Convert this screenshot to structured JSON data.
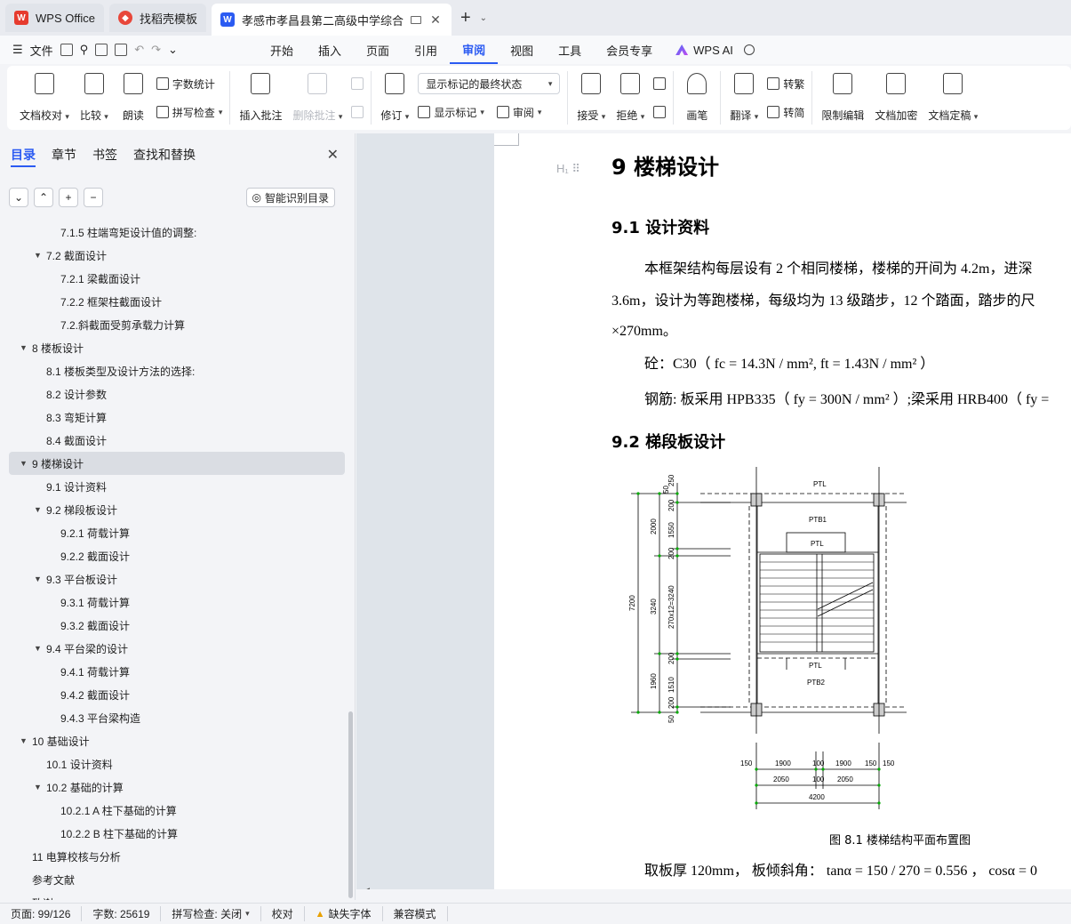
{
  "tabs": [
    {
      "label": "WPS Office",
      "icon": "wps-logo-icon"
    },
    {
      "label": "找稻壳模板",
      "icon": "docer-logo-icon"
    },
    {
      "label": "孝感市孝昌县第二高级中学综合",
      "icon": "writer-logo-icon",
      "active": true
    }
  ],
  "menu": {
    "file": "文件",
    "items": [
      "开始",
      "插入",
      "页面",
      "引用",
      "审阅",
      "视图",
      "工具",
      "会员专享"
    ],
    "active": "审阅",
    "ai": "WPS AI"
  },
  "ribbon": {
    "doc_compare": "文档校对",
    "compare": "比较",
    "read_aloud": "朗读",
    "word_count": "字数统计",
    "spell_check": "拼写检查",
    "insert_comment": "插入批注",
    "delete_comment": "删除批注",
    "track_changes": "修订",
    "markup_dropdown": "显示标记的最终状态",
    "show_markup": "显示标记",
    "review": "审阅",
    "accept": "接受",
    "reject": "拒绝",
    "ink": "画笔",
    "translate": "翻译",
    "to_traditional": "转繁",
    "to_simplified": "转简",
    "restrict_edit": "限制编辑",
    "encrypt": "文档加密",
    "finalize": "文档定稿"
  },
  "panel": {
    "tabs": [
      "目录",
      "章节",
      "书签",
      "查找和替换"
    ],
    "active_tab": "目录",
    "smart_toc": "智能识别目录",
    "toc": [
      {
        "level": 3,
        "text": "7.1.5 柱端弯矩设计值的调整:",
        "arrow": false
      },
      {
        "level": 2,
        "text": "7.2 截面设计",
        "arrow": true
      },
      {
        "level": 3,
        "text": "7.2.1 梁截面设计",
        "arrow": false
      },
      {
        "level": 3,
        "text": "7.2.2 框架柱截面设计",
        "arrow": false
      },
      {
        "level": 3,
        "text": "7.2.斜截面受剪承载力计算",
        "arrow": false
      },
      {
        "level": 1,
        "text": "8  楼板设计",
        "arrow": true
      },
      {
        "level": 2,
        "text": "8.1 楼板类型及设计方法的选择:",
        "arrow": false
      },
      {
        "level": 2,
        "text": "8.2 设计参数",
        "arrow": false
      },
      {
        "level": 2,
        "text": "8.3 弯矩计算",
        "arrow": false
      },
      {
        "level": 2,
        "text": "8.4 截面设计",
        "arrow": false
      },
      {
        "level": 1,
        "text": "9  楼梯设计",
        "arrow": true,
        "selected": true
      },
      {
        "level": 2,
        "text": "9.1 设计资料",
        "arrow": false
      },
      {
        "level": 2,
        "text": "9.2 梯段板设计",
        "arrow": true
      },
      {
        "level": 3,
        "text": "9.2.1 荷载计算",
        "arrow": false
      },
      {
        "level": 3,
        "text": "9.2.2 截面设计",
        "arrow": false
      },
      {
        "level": 2,
        "text": "9.3 平台板设计",
        "arrow": true
      },
      {
        "level": 3,
        "text": "9.3.1 荷载计算",
        "arrow": false
      },
      {
        "level": 3,
        "text": "9.3.2 截面设计",
        "arrow": false
      },
      {
        "level": 2,
        "text": "9.4 平台梁的设计",
        "arrow": true
      },
      {
        "level": 3,
        "text": "9.4.1 荷载计算",
        "arrow": false
      },
      {
        "level": 3,
        "text": "9.4.2 截面设计",
        "arrow": false
      },
      {
        "level": 3,
        "text": "9.4.3 平台梁构造",
        "arrow": false
      },
      {
        "level": 1,
        "text": "10  基础设计",
        "arrow": true
      },
      {
        "level": 2,
        "text": "10.1 设计资料",
        "arrow": false
      },
      {
        "level": 2,
        "text": "10.2 基础的计算",
        "arrow": true
      },
      {
        "level": 3,
        "text": "10.2.1 A 柱下基础的计算",
        "arrow": false
      },
      {
        "level": 3,
        "text": "10.2.2 B 柱下基础的计算",
        "arrow": false
      },
      {
        "level": 1,
        "text": "11  电算校核与分析",
        "arrow": false
      },
      {
        "level": 1,
        "text": "参考文献",
        "arrow": false
      },
      {
        "level": 1,
        "text": "致谢",
        "arrow": false
      }
    ]
  },
  "document": {
    "h1": "9  楼梯设计",
    "h2_1": "9.1 设计资料",
    "p1": "本框架结构每层设有 2 个相同楼梯，楼梯的开间为 4.2m，进深",
    "p2": "3.6m，设计为等跑楼梯，每级均为 13 级踏步，12 个踏面，踏步的尺",
    "p3": "×270mm。",
    "p4": "砼：C30（ fc = 14.3N / mm², ft = 1.43N / mm² ）",
    "p5": "钢筋: 板采用 HPB335（ fy = 300N / mm² ）;梁采用 HRB400（ fy =",
    "h2_2": "9.2 梯段板设计",
    "caption": "图 8.1  楼梯结构平面布置图",
    "p6": "取板厚 120mm，  板倾斜角：  tanα = 150 / 270 = 0.556   ，  cosα = 0",
    "drawing_labels": {
      "ptl_top": "PTL",
      "ptb1": "PTB1",
      "ptl_mid": "PTL",
      "ptl_low": "PTL",
      "ptb2": "PTB2",
      "dim_7200": "7200",
      "dim_2000": "2000",
      "dim_3240": "3240",
      "dim_1960": "1960",
      "dim_1550": "1550",
      "dim_200a": "200",
      "dim_200b": "200",
      "dim_270x12": "270x12=3240",
      "dim_200c": "200",
      "dim_1510": "1510",
      "dim_200d": "200",
      "dim_50a": "50",
      "dim_250": "250",
      "dim_50b": "50",
      "dim_150a": "150",
      "dim_1900a": "1900",
      "dim_100a": "100",
      "dim_1900b": "1900",
      "dim_150b": "150",
      "dim_150c": "150",
      "dim_2050a": "2050",
      "dim_100b": "100",
      "dim_2050b": "2050",
      "dim_4200": "4200"
    }
  },
  "status": {
    "page": "页面: 99/126",
    "words": "字数: 25619",
    "spell": "拼写检查: 关闭",
    "proof": "校对",
    "missing_font": "缺失字体",
    "compat": "兼容模式"
  }
}
